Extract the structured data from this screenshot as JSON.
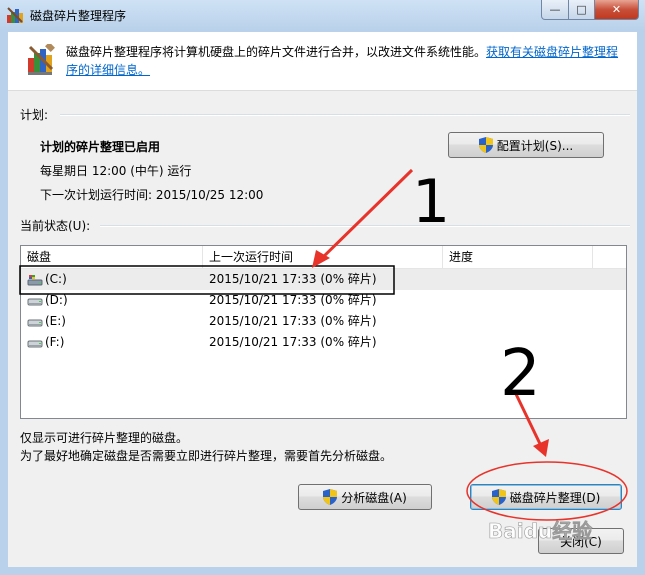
{
  "window": {
    "title": "磁盘碎片整理程序"
  },
  "caption": {
    "min": "—",
    "max": "□",
    "close": "✕"
  },
  "header": {
    "description": "磁盘碎片整理程序将计算机硬盘上的碎片文件进行合并，以改进文件系统性能。",
    "link": "获取有关磁盘碎片整理程序的详细信息。"
  },
  "schedule": {
    "section_label": "计划:",
    "status": "计划的碎片整理已启用",
    "frequency": "每星期日  12:00 (中午) 运行",
    "next_run": "下一次计划运行时间: 2015/10/25 12:00",
    "configure_button": "配置计划(S)..."
  },
  "current_status": {
    "section_label": "当前状态(U):",
    "columns": [
      "磁盘",
      "上一次运行时间",
      "进度"
    ],
    "rows": [
      {
        "disk": "(C:)",
        "last_run": "2015/10/21 17:33 (0% 碎片)",
        "progress": "",
        "selected": true,
        "icon": "system-drive-icon"
      },
      {
        "disk": "(D:)",
        "last_run": "2015/10/21 17:33 (0% 碎片)",
        "progress": "",
        "selected": false,
        "icon": "drive-icon"
      },
      {
        "disk": "(E:)",
        "last_run": "2015/10/21 17:33 (0% 碎片)",
        "progress": "",
        "selected": false,
        "icon": "drive-icon"
      },
      {
        "disk": "(F:)",
        "last_run": "2015/10/21 17:33 (0% 碎片)",
        "progress": "",
        "selected": false,
        "icon": "drive-icon"
      }
    ]
  },
  "notes": {
    "line1": "仅显示可进行碎片整理的磁盘。",
    "line2": "为了最好地确定磁盘是否需要立即进行碎片整理，需要首先分析磁盘。"
  },
  "buttons": {
    "analyze": "分析磁盘(A)",
    "defragment": "磁盘碎片整理(D)",
    "close": "关闭(C)"
  },
  "annotations": {
    "mark1": "1",
    "mark2": "2"
  },
  "watermark": "Baidu经验",
  "colors": {
    "annotation_red": "#e8332b",
    "link_blue": "#0066cc"
  }
}
